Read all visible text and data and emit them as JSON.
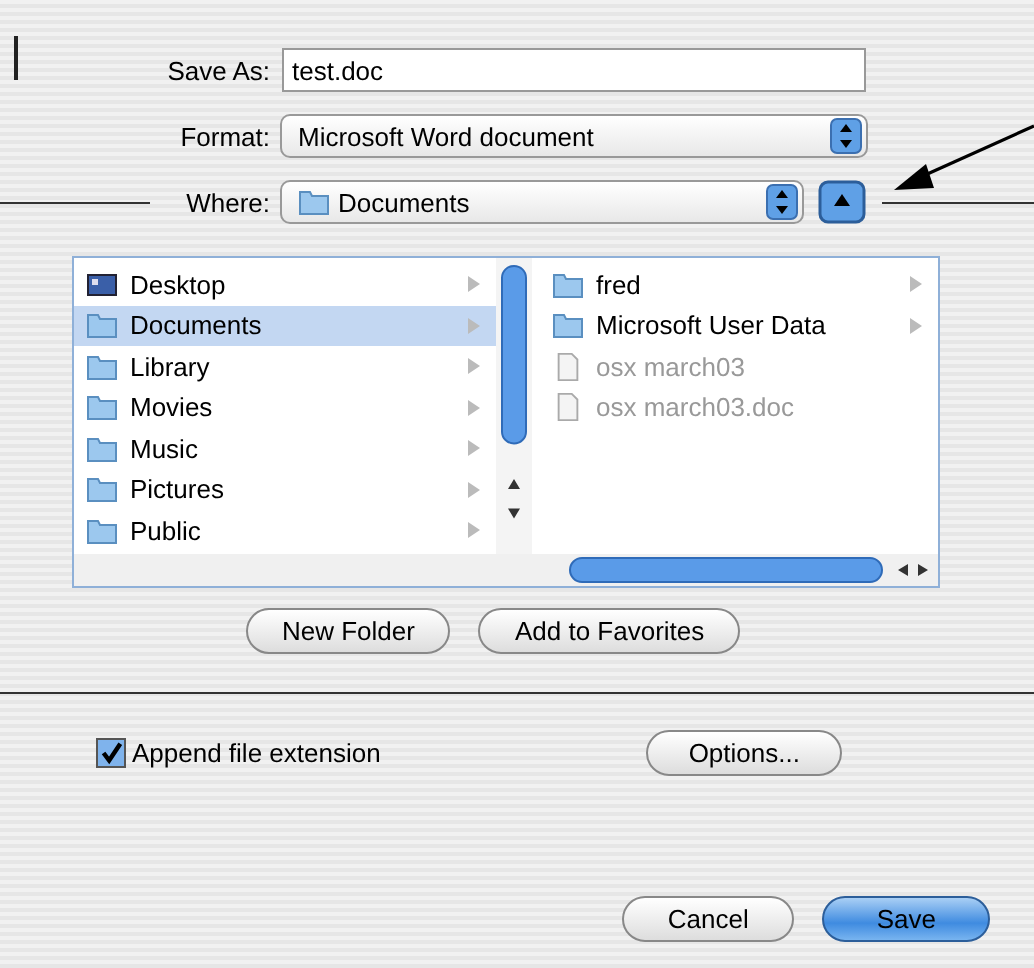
{
  "save_as": {
    "label": "Save As:",
    "value": "test.doc"
  },
  "format": {
    "label": "Format:",
    "value": "Microsoft Word document"
  },
  "where": {
    "label": "Where:",
    "value": "Documents"
  },
  "browser": {
    "column_1": [
      {
        "name": "Desktop",
        "kind": "desktop",
        "selected": false
      },
      {
        "name": "Documents",
        "kind": "folder",
        "selected": true
      },
      {
        "name": "Library",
        "kind": "folder",
        "selected": false
      },
      {
        "name": "Movies",
        "kind": "folder",
        "selected": false
      },
      {
        "name": "Music",
        "kind": "folder",
        "selected": false
      },
      {
        "name": "Pictures",
        "kind": "folder",
        "selected": false
      },
      {
        "name": "Public",
        "kind": "folder",
        "selected": false
      }
    ],
    "column_2": [
      {
        "name": "fred",
        "kind": "folder",
        "disabled": false
      },
      {
        "name": "Microsoft User Data",
        "kind": "folder",
        "disabled": false
      },
      {
        "name": "osx march03",
        "kind": "document",
        "disabled": true
      },
      {
        "name": "osx march03.doc",
        "kind": "document",
        "disabled": true
      }
    ]
  },
  "folder_buttons": [
    "New Folder",
    "Add to Favorites"
  ],
  "append_extension": {
    "label": "Append file extension",
    "checked": true
  },
  "options_button": "Options...",
  "buttons": [
    {
      "label": "Cancel",
      "kind": "normal"
    },
    {
      "label": "Save",
      "kind": "default"
    }
  ]
}
